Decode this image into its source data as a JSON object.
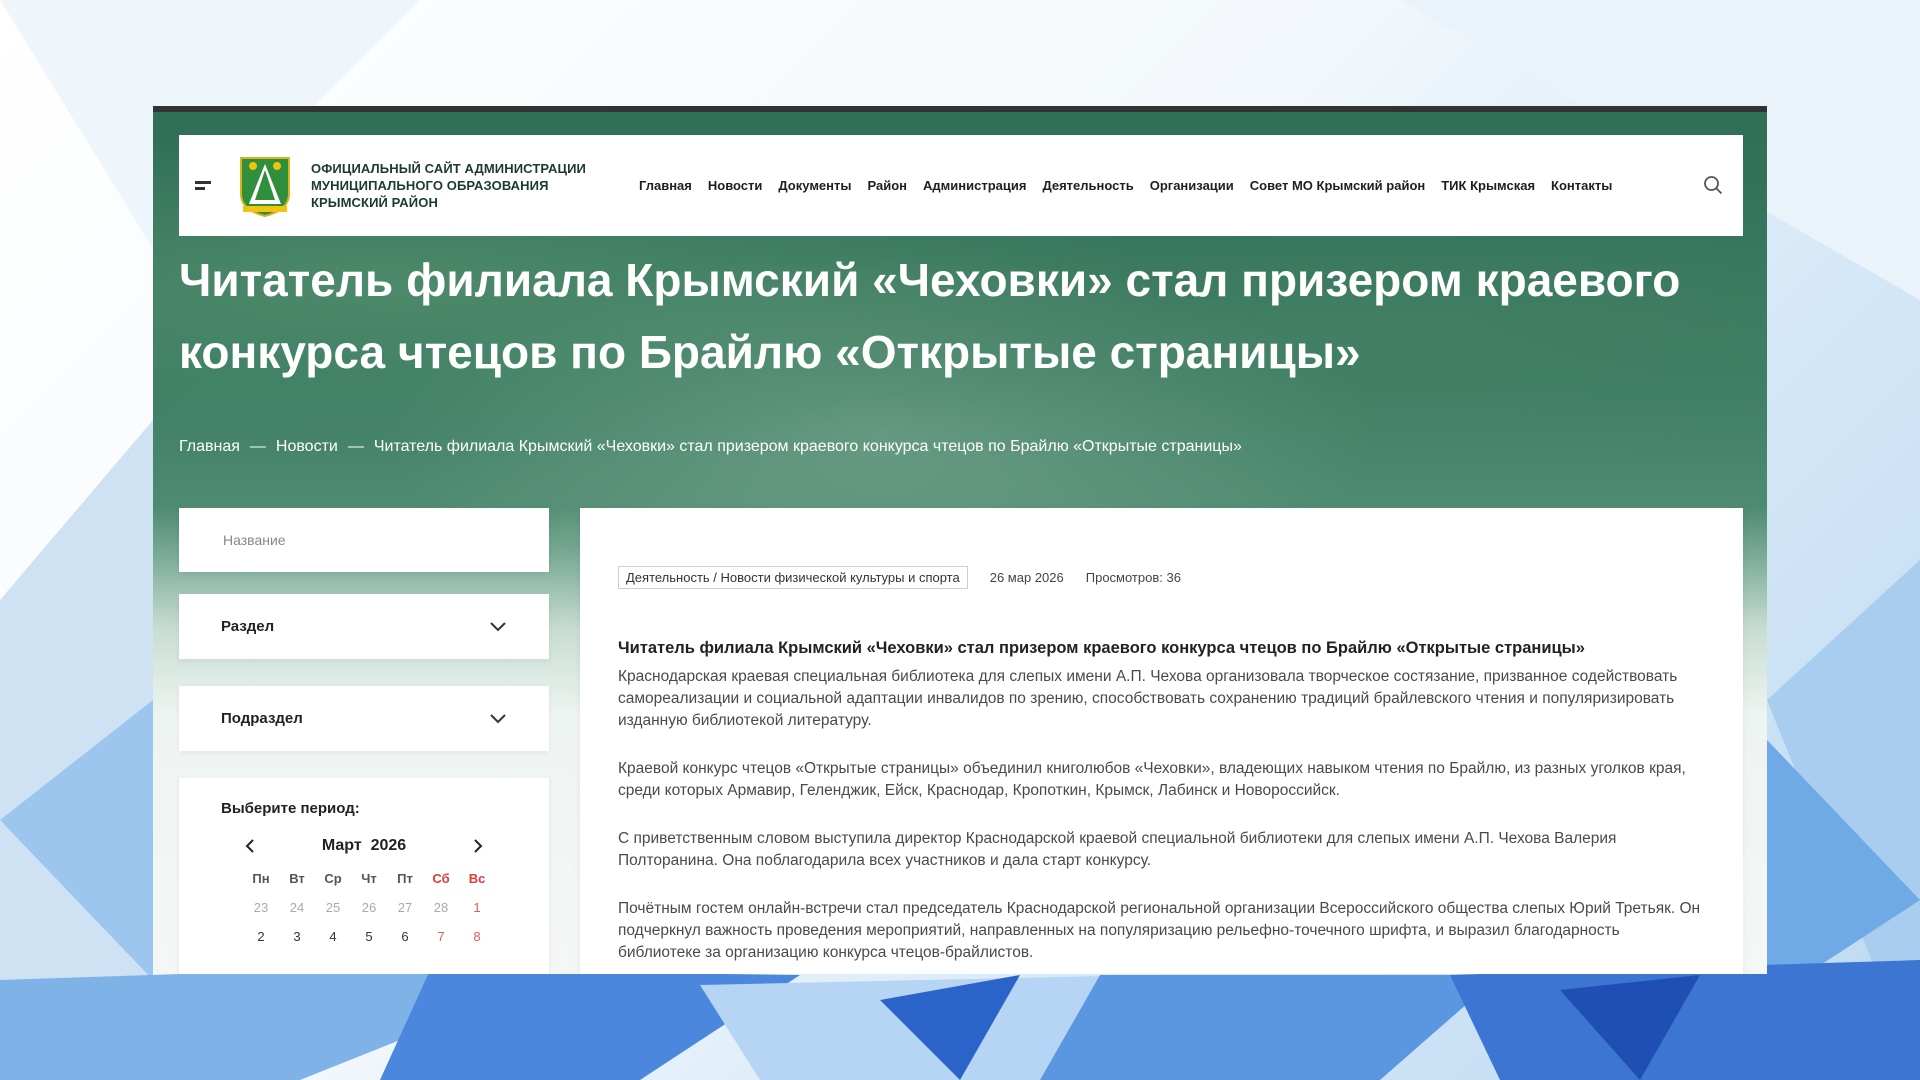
{
  "header": {
    "site_title": "Официальный сайт администрации муниципального образования Крымский район",
    "nav": [
      "Главная",
      "Новости",
      "Документы",
      "Район",
      "Администрация",
      "Деятельность",
      "Организации",
      "Совет МО Крымский район",
      "ТИК Крымская",
      "Контакты"
    ]
  },
  "hero": {
    "title": "Читатель филиала Крымский «Чеховки» стал призером краевого конкурса чтецов по Брайлю «Открытые страницы»",
    "breadcrumb": [
      "Главная",
      "Новости",
      "Читатель филиала Крымский «Чеховки» стал призером краевого конкурса чтецов по Брайлю «Открытые страницы»"
    ],
    "breadcrumb_sep": "—"
  },
  "sidebar": {
    "name_placeholder": "Название",
    "section_label": "Раздел",
    "subsection_label": "Подраздел",
    "period_label": "Выберите период:",
    "calendar": {
      "month": "Март",
      "year": "2026",
      "weekdays": [
        "Пн",
        "Вт",
        "Ср",
        "Чт",
        "Пт",
        "Сб",
        "Вс"
      ],
      "week1": [
        "23",
        "24",
        "25",
        "26",
        "27",
        "28",
        "1"
      ],
      "week2": [
        "2",
        "3",
        "4",
        "5",
        "6",
        "7",
        "8"
      ]
    }
  },
  "article": {
    "category": "Деятельность / Новости физической культуры и спорта",
    "date": "26 мар 2026",
    "views": "Просмотров: 36",
    "heading": "Читатель филиала Крымский «Чеховки» стал призером краевого конкурса чтецов по Брайлю «Открытые страницы»",
    "paragraphs": [
      "Краснодарская краевая специальная библиотека для слепых имени А.П. Чехова организовала творческое состязание, призванное содействовать самореализации и социальной адаптации инвалидов по зрению, способствовать сохранению традиций брайлевского чтения и популяризировать изданную библиотекой литературу.",
      "Краевой конкурс чтецов «Открытые страницы» объединил книголюбов «Чеховки», владеющих навыком чтения по Брайлю, из разных уголков края, среди которых Армавир, Геленджик, Ейск, Краснодар, Кропоткин, Крымск, Лабинск и Новороссийск.",
      "С приветственным словом выступила директор Краснодарской краевой специальной библиотеки для слепых имени А.П. Чехова Валерия Полторанина. Она поблагодарила всех участников и дала старт конкурсу.",
      "Почётным гостем онлайн-встречи стал председатель Краснодарской региональной организации Всероссийского общества слепых Юрий Третьяк. Он подчеркнул важность проведения мероприятий, направленных на популяризацию рельефно-точечного шрифта, и выразил благодарность библиотеке за организацию конкурса чтецов-брайлистов."
    ]
  },
  "colors": {
    "brand_green": "#2f6f56",
    "weekend_red": "#e03b3b"
  },
  "icons": [
    "menu-icon",
    "coat-of-arms-logo",
    "search-icon",
    "chevron-down-icon",
    "chevron-left-icon",
    "chevron-right-icon"
  ]
}
